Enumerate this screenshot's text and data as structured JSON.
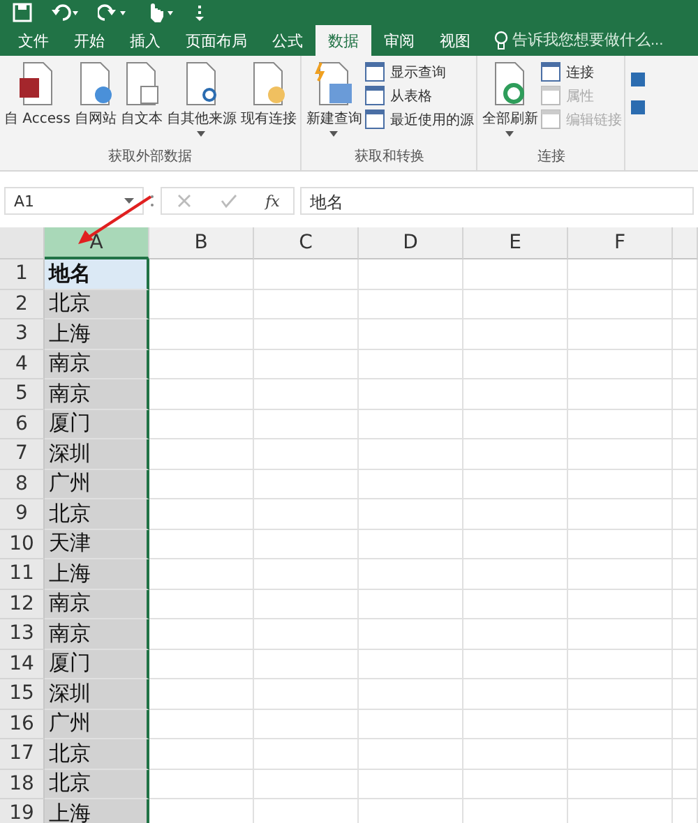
{
  "tabs": [
    {
      "label": "文件",
      "selected": false
    },
    {
      "label": "开始",
      "selected": false
    },
    {
      "label": "插入",
      "selected": false
    },
    {
      "label": "页面布局",
      "selected": false
    },
    {
      "label": "公式",
      "selected": false
    },
    {
      "label": "数据",
      "selected": true
    },
    {
      "label": "审阅",
      "selected": false
    },
    {
      "label": "视图",
      "selected": false
    }
  ],
  "tell_me": {
    "placeholder": "告诉我您想要做什么..."
  },
  "ribbon": {
    "groups": [
      {
        "label": "获取外部数据",
        "items": [
          {
            "kind": "large",
            "label": "自 Access",
            "disabled": false,
            "dropdown": false
          },
          {
            "kind": "large",
            "label": "自网站",
            "disabled": false,
            "dropdown": false
          },
          {
            "kind": "large",
            "label": "自文本",
            "disabled": false,
            "dropdown": false
          },
          {
            "kind": "large",
            "label": "自其他来源",
            "disabled": false,
            "dropdown": true
          },
          {
            "kind": "large",
            "label": "现有连接",
            "disabled": false,
            "dropdown": false
          }
        ]
      },
      {
        "label": "获取和转换",
        "items": [
          {
            "kind": "large",
            "label": "新建查询",
            "disabled": false,
            "dropdown": true
          },
          {
            "kind": "small",
            "label": "显示查询",
            "disabled": false
          },
          {
            "kind": "small",
            "label": "从表格",
            "disabled": false
          },
          {
            "kind": "small",
            "label": "最近使用的源",
            "disabled": false
          }
        ]
      },
      {
        "label": "连接",
        "items": [
          {
            "kind": "large",
            "label": "全部刷新",
            "disabled": false,
            "dropdown": true
          },
          {
            "kind": "small",
            "label": "连接",
            "disabled": false
          },
          {
            "kind": "small",
            "label": "属性",
            "disabled": true
          },
          {
            "kind": "small",
            "label": "编辑链接",
            "disabled": true
          }
        ]
      }
    ]
  },
  "formula_bar": {
    "name_box": "A1",
    "fx": "fx",
    "formula": "地名"
  },
  "sheet": {
    "columns": [
      {
        "label": "A",
        "selected": true
      },
      {
        "label": "B",
        "selected": false
      },
      {
        "label": "C",
        "selected": false
      },
      {
        "label": "D",
        "selected": false
      },
      {
        "label": "E",
        "selected": false
      },
      {
        "label": "F",
        "selected": false
      }
    ],
    "rows": [
      {
        "number": "1",
        "value": "地名",
        "active": true
      },
      {
        "number": "2",
        "value": "北京",
        "active": false
      },
      {
        "number": "3",
        "value": "上海",
        "active": false
      },
      {
        "number": "4",
        "value": "南京",
        "active": false
      },
      {
        "number": "5",
        "value": "南京",
        "active": false
      },
      {
        "number": "6",
        "value": "厦门",
        "active": false
      },
      {
        "number": "7",
        "value": "深圳",
        "active": false
      },
      {
        "number": "8",
        "value": "广州",
        "active": false
      },
      {
        "number": "9",
        "value": "北京",
        "active": false
      },
      {
        "number": "10",
        "value": "天津",
        "active": false
      },
      {
        "number": "11",
        "value": "上海",
        "active": false
      },
      {
        "number": "12",
        "value": "南京",
        "active": false
      },
      {
        "number": "13",
        "value": "南京",
        "active": false
      },
      {
        "number": "14",
        "value": "厦门",
        "active": false
      },
      {
        "number": "15",
        "value": "深圳",
        "active": false
      },
      {
        "number": "16",
        "value": "广州",
        "active": false
      },
      {
        "number": "17",
        "value": "北京",
        "active": false
      },
      {
        "number": "18",
        "value": "北京",
        "active": false
      },
      {
        "number": "19",
        "value": "上海",
        "active": false
      }
    ]
  }
}
